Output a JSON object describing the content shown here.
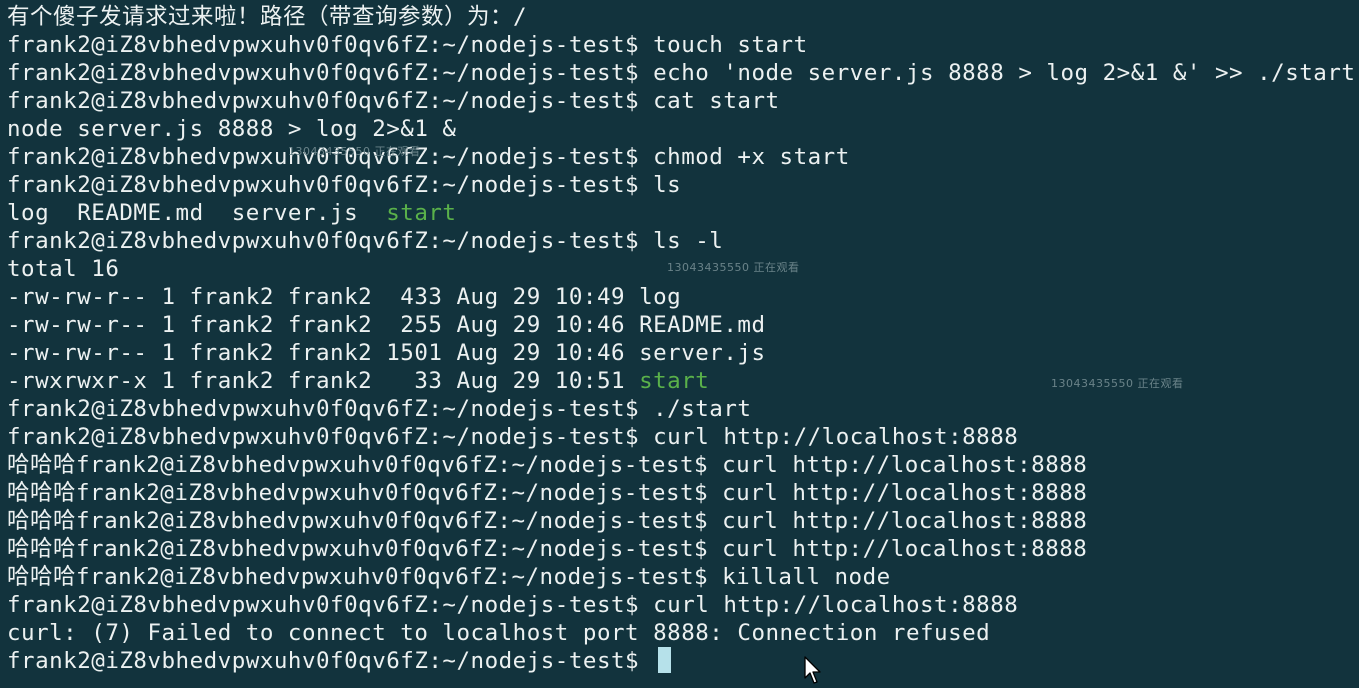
{
  "terminal": {
    "prompt": "frank2@iZ8vbhedvpwxuhv0f0qv6fZ:~/nodejs-test$ ",
    "response_prefix": "哈哈哈",
    "lines": [
      {
        "text": "有个傻子发请求过来啦！路径（带查询参数）为：/"
      },
      {
        "prompt": true,
        "text": "touch start"
      },
      {
        "prompt": true,
        "text": "echo 'node server.js 8888 > log 2>&1 &' >> ./start"
      },
      {
        "prompt": true,
        "text": "cat start"
      },
      {
        "text": "node server.js 8888 > log 2>&1 &"
      },
      {
        "prompt": true,
        "text": "chmod +x start"
      },
      {
        "prompt": true,
        "text": "ls"
      },
      {
        "text": "log  README.md  server.js  ",
        "highlight": "start"
      },
      {
        "prompt": true,
        "text": "ls -l"
      },
      {
        "text": "total 16"
      },
      {
        "text": "-rw-rw-r-- 1 frank2 frank2  433 Aug 29 10:49 log"
      },
      {
        "text": "-rw-rw-r-- 1 frank2 frank2  255 Aug 29 10:46 README.md"
      },
      {
        "text": "-rw-rw-r-- 1 frank2 frank2 1501 Aug 29 10:46 server.js"
      },
      {
        "text": "-rwxrwxr-x 1 frank2 frank2   33 Aug 29 10:51 ",
        "highlight": "start"
      },
      {
        "prompt": true,
        "text": "./start"
      },
      {
        "prompt": true,
        "text": "curl http://localhost:8888"
      },
      {
        "prefix": true,
        "prompt": true,
        "text": "curl http://localhost:8888"
      },
      {
        "prefix": true,
        "prompt": true,
        "text": "curl http://localhost:8888"
      },
      {
        "prefix": true,
        "prompt": true,
        "text": "curl http://localhost:8888"
      },
      {
        "prefix": true,
        "prompt": true,
        "text": "curl http://localhost:8888"
      },
      {
        "prefix": true,
        "prompt": true,
        "text": "killall node"
      },
      {
        "prompt": true,
        "text": "curl http://localhost:8888"
      },
      {
        "text": "curl: (7) Failed to connect to localhost port 8888: Connection refused"
      },
      {
        "prompt": true,
        "text": "",
        "cursor": true
      }
    ]
  },
  "watermarks": [
    "13043435550 正在观看",
    "13043435550 正在观看",
    "13043435550 正在观看"
  ],
  "colors": {
    "background": "#12333d",
    "foreground": "#ecf1f1",
    "executable": "#5ab14a",
    "cursor": "#b6e1ea"
  },
  "icons": {
    "pointer": "mouse-pointer-icon"
  }
}
